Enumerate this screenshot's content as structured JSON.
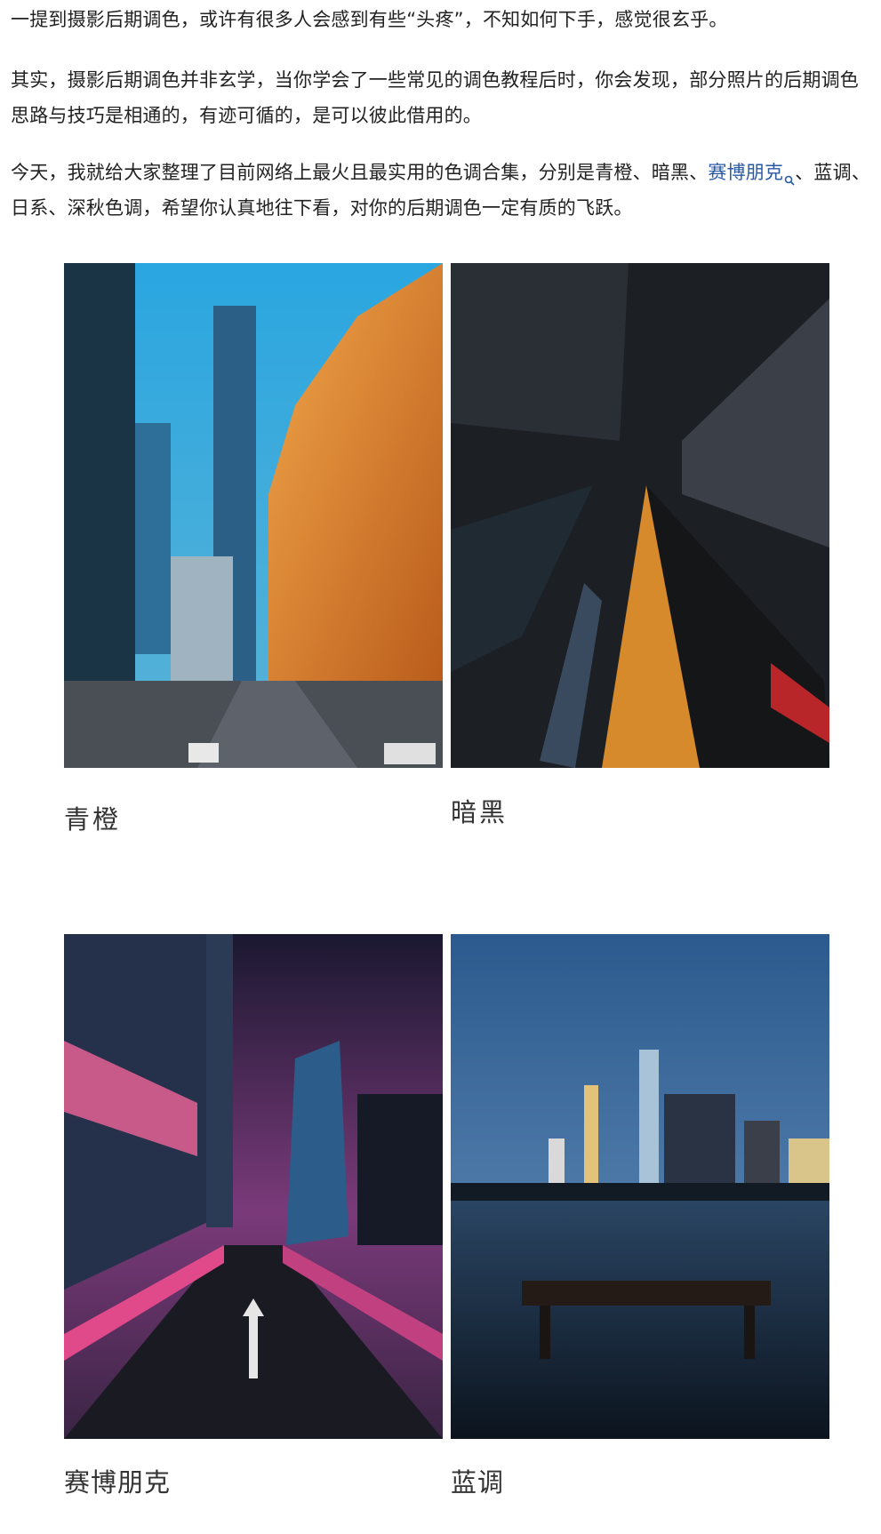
{
  "paragraphs": {
    "p1": "一提到摄影后期调色，或许有很多人会感到有些“头疼”，不知如何下手，感觉很玄乎。",
    "p2": "其实，摄影后期调色并非玄学，当你学会了一些常见的调色教程后时，你会发现，部分照片的后期调色思路与技巧是相通的，有迹可循的，是可以彼此借用的。",
    "p3_before": "今天，我就给大家整理了目前网络上最火且最实用的色调合集，分别是青橙、暗黑、",
    "p3_link": "赛博朋克",
    "p3_after": "、蓝调、日系、深秋色调，希望你认真地往下看，对你的后期调色一定有质的飞跃。"
  },
  "link_color": "#2b5aa5",
  "captions": {
    "c1": "青橙",
    "c2": "暗黑",
    "c3": "赛博朋克",
    "c4": "蓝调"
  },
  "photos": [
    {
      "name": "teal-orange-city-photo",
      "palette": [
        "#2b9bd3",
        "#e88a2b"
      ]
    },
    {
      "name": "dark-skyscrapers-photo",
      "palette": [
        "#1a1d22",
        "#d77a2a"
      ]
    },
    {
      "name": "cyberpunk-street-photo",
      "palette": [
        "#3a1d4d",
        "#e04a8a"
      ]
    },
    {
      "name": "blue-hour-skyline-photo",
      "palette": [
        "#2f5a8c",
        "#0d1622"
      ]
    }
  ]
}
